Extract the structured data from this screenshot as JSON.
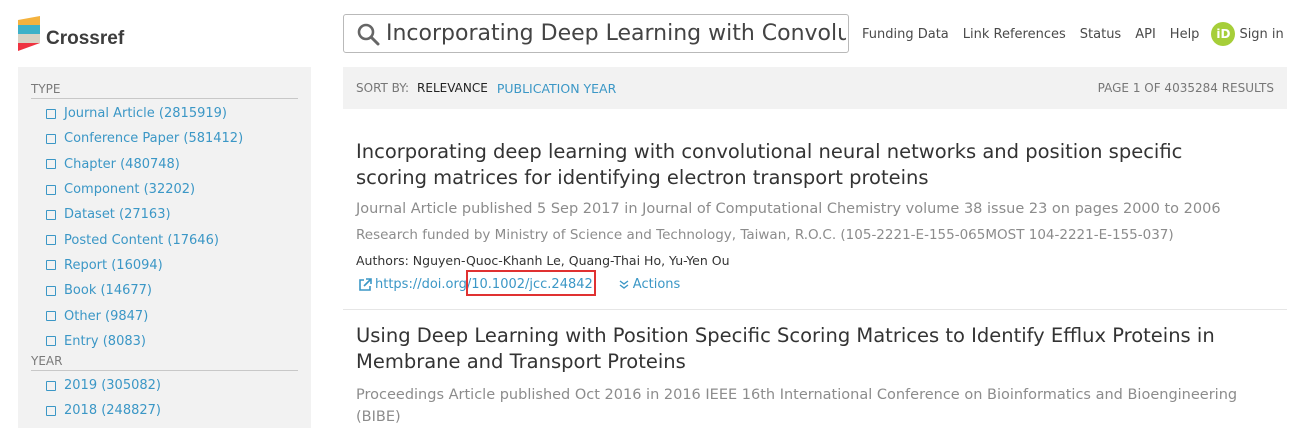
{
  "brand": {
    "name": "Crossref"
  },
  "search": {
    "query": "Incorporating Deep Learning with Convoluti"
  },
  "nav": {
    "links": [
      "Funding Data",
      "Link References",
      "Status",
      "API",
      "Help"
    ],
    "signin_label": "Sign in",
    "orcid_text": "iD"
  },
  "sidebar": {
    "type_heading": "TYPE",
    "type_items": [
      "Journal Article (2815919)",
      "Conference Paper (581412)",
      "Chapter (480748)",
      "Component (32202)",
      "Dataset (27163)",
      "Posted Content (17646)",
      "Report (16094)",
      "Book (14677)",
      "Other (9847)",
      "Entry (8083)"
    ],
    "year_heading": "YEAR",
    "year_items": [
      "2019 (305082)",
      "2018 (248827)"
    ]
  },
  "sort": {
    "label": "SORT BY:",
    "active": "RELEVANCE",
    "option": "PUBLICATION YEAR",
    "page_info": "PAGE 1 OF 4035284 RESULTS"
  },
  "results": [
    {
      "title_line1": "Incorporating deep learning with convolutional neural networks and position specific",
      "title_line2": "scoring matrices for identifying electron transport proteins",
      "meta": "Journal Article published 5 Sep 2017 in Journal of Computational Chemistry volume 38 issue 23 on pages 2000 to 2006",
      "funding": "Research funded by Ministry of Science and Technology, Taiwan, R.O.C. (105-2221-E-155-065MOST 104-2221-E-155-037)",
      "authors": "Authors: Nguyen-Quoc-Khanh Le, Quang-Thai Ho, Yu-Yen Ou",
      "doi_prefix": "https://doi.org/",
      "doi_suffix": "10.1002/jcc.24842",
      "actions_label": "Actions"
    },
    {
      "title_line1": "Using Deep Learning with Position Specific Scoring Matrices to Identify Efflux Proteins in",
      "title_line2": "Membrane and Transport Proteins",
      "meta_line1": "Proceedings Article published Oct 2016 in 2016 IEEE 16th International Conference on Bioinformatics and Bioengineering",
      "meta_line2": "(BIBE)"
    }
  ],
  "colors": {
    "link": "#3b97c6",
    "highlight": "#e03131",
    "orcid": "#a6ce39"
  },
  "icons": {
    "search": "search-icon",
    "external": "external-link-icon",
    "actions": "chevron-double-down-icon"
  }
}
